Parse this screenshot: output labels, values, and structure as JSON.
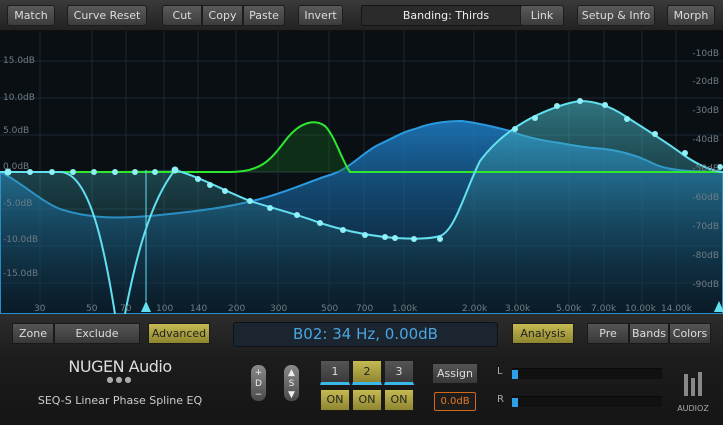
{
  "toolbar": {
    "match": "Match",
    "curve_reset": "Curve Reset",
    "cut": "Cut",
    "copy": "Copy",
    "paste": "Paste",
    "invert": "Invert",
    "banding": "Banding: Thirds",
    "link": "Link",
    "setup": "Setup & Info",
    "morph": "Morph"
  },
  "graph": {
    "db_left": [
      "15.0dB",
      "10.0dB",
      "5.0dB",
      "0.0dB",
      "-5.0dB",
      "-10.0dB",
      "-15.0dB"
    ],
    "db_right": [
      "-10dB",
      "-20dB",
      "-30dB",
      "-40dB",
      "-50dB",
      "-60dB",
      "-70dB",
      "-80dB",
      "-90dB"
    ],
    "freq_labels": [
      "30",
      "50",
      "70",
      "100",
      "140",
      "200",
      "300",
      "500",
      "700",
      "1.00k",
      "2.00k",
      "3.00k",
      "5.00k",
      "7.00k",
      "10.00k",
      "14.00k"
    ],
    "colors": {
      "curve": "#63e0f0",
      "spectrum": "#1f8fd8",
      "green": "#2ee830",
      "bg": "#0a0f14"
    }
  },
  "controls": {
    "zone": "Zone",
    "exclude": "Exclude",
    "advanced": "Advanced",
    "status_text": "B02: 34 Hz, 0.00dB",
    "analysis": "Analysis",
    "pre": "Pre",
    "bands": "Bands",
    "colors": "Colors"
  },
  "brand": {
    "name": "NUGEN Audio",
    "product": "SEQ-S Linear Phase Spline EQ"
  },
  "bands": {
    "items": [
      {
        "label": "1",
        "on": "ON",
        "selected": false
      },
      {
        "label": "2",
        "on": "ON",
        "selected": true
      },
      {
        "label": "3",
        "on": "ON",
        "selected": false
      }
    ],
    "assign": "Assign",
    "gain": "0.0dB"
  },
  "knobs": {
    "d_top": "+",
    "d_mid": "D",
    "d_bot": "−",
    "s": "S"
  },
  "meters": {
    "left_label": "L",
    "right_label": "R",
    "left_level": 0.04,
    "right_level": 0.04
  },
  "watermark": "AUDIOZ"
}
